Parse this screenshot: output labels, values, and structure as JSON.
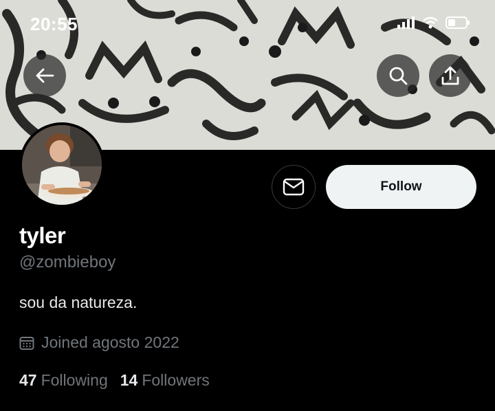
{
  "status_bar": {
    "time": "20:55"
  },
  "banner": {
    "description_icon": "graffiti-cats-banner"
  },
  "header_buttons": {
    "back_icon": "arrow-left-icon",
    "search_icon": "search-icon",
    "share_icon": "share-icon"
  },
  "profile": {
    "name": "tyler",
    "handle": "@zombieboy",
    "bio": "sou da natureza.",
    "joined": "Joined agosto 2022",
    "follow_label": "Follow",
    "following_count": "47",
    "following_label": "Following",
    "followers_count": "14",
    "followers_label": "Followers"
  },
  "colors": {
    "background": "#000000",
    "secondary_text": "#71767b",
    "follow_button_bg": "#eff3f4"
  }
}
